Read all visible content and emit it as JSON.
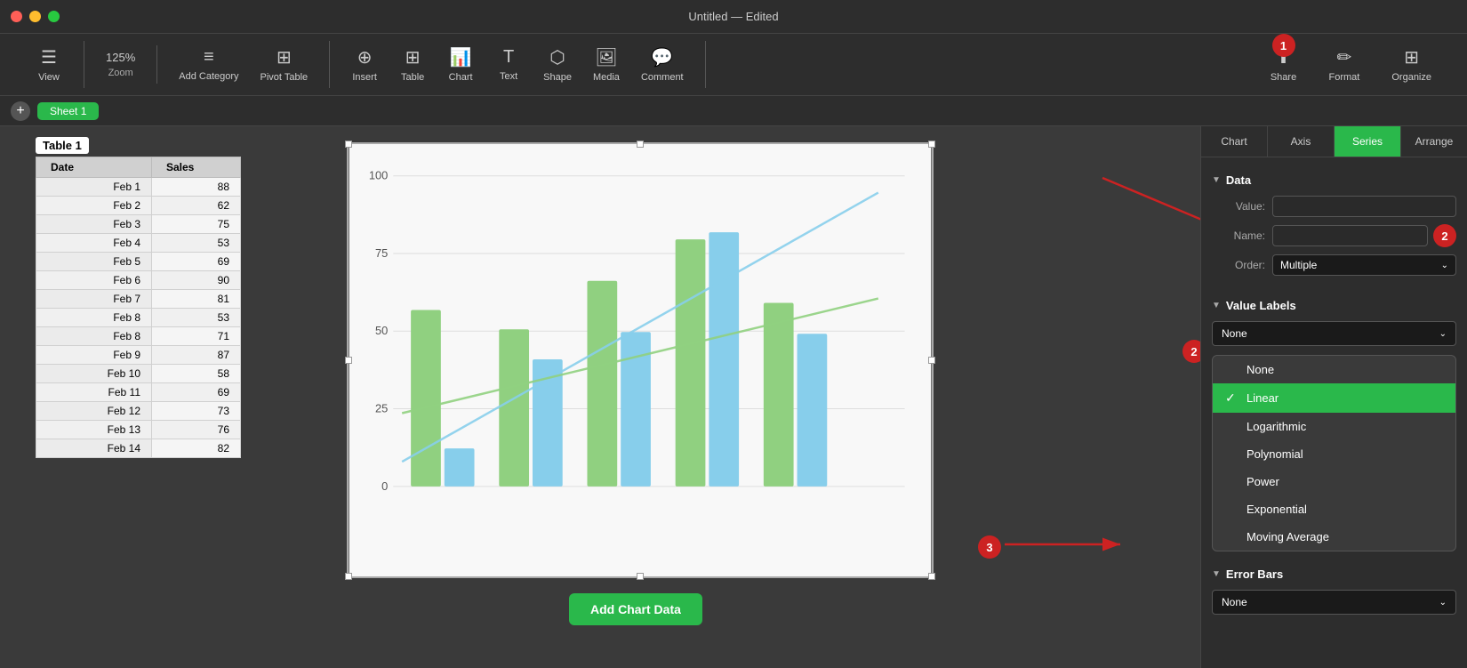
{
  "window": {
    "title": "Untitled — Edited",
    "traffic_lights": [
      "red",
      "yellow",
      "green"
    ]
  },
  "toolbar": {
    "view_label": "View",
    "zoom_value": "125%",
    "zoom_label": "Zoom",
    "add_category_label": "Add Category",
    "pivot_table_label": "Pivot Table",
    "insert_label": "Insert",
    "table_label": "Table",
    "chart_label": "Chart",
    "text_label": "Text",
    "shape_label": "Shape",
    "media_label": "Media",
    "comment_label": "Comment",
    "share_label": "Share",
    "format_label": "Format",
    "organize_label": "Organize"
  },
  "sheets": {
    "add_label": "+",
    "tabs": [
      {
        "name": "Sheet 1",
        "active": true
      }
    ]
  },
  "table": {
    "title": "Table 1",
    "columns": [
      "Date",
      "Sales"
    ],
    "rows": [
      [
        "Feb 1",
        "88"
      ],
      [
        "Feb 2",
        "62"
      ],
      [
        "Feb 3",
        "75"
      ],
      [
        "Feb 4",
        "53"
      ],
      [
        "Feb 5",
        "69"
      ],
      [
        "Feb 6",
        "90"
      ],
      [
        "Feb 7",
        "81"
      ],
      [
        "Feb 8",
        "53"
      ],
      [
        "Feb 8",
        "71"
      ],
      [
        "Feb 9",
        "87"
      ],
      [
        "Feb 10",
        "58"
      ],
      [
        "Feb 11",
        "69"
      ],
      [
        "Feb 12",
        "73"
      ],
      [
        "Feb 13",
        "76"
      ],
      [
        "Feb 14",
        "82"
      ]
    ]
  },
  "chart": {
    "y_labels": [
      "100",
      "75",
      "50",
      "25",
      "0"
    ],
    "add_data_label": "Add Chart Data"
  },
  "right_panel": {
    "tabs": [
      "Chart",
      "Axis",
      "Series",
      "Arrange"
    ],
    "active_tab": "Series",
    "data_section": {
      "title": "Data",
      "value_label": "Value:",
      "name_label": "Name:",
      "order_label": "Order:",
      "order_value": "Multiple"
    },
    "value_labels_section": {
      "title": "Value Labels",
      "current_value": "None"
    },
    "dropdown_items": [
      {
        "label": "None",
        "selected": false
      },
      {
        "label": "Linear",
        "selected": true
      },
      {
        "label": "Logarithmic",
        "selected": false
      },
      {
        "label": "Polynomial",
        "selected": false
      },
      {
        "label": "Power",
        "selected": false
      },
      {
        "label": "Exponential",
        "selected": false
      },
      {
        "label": "Moving Average",
        "selected": false
      }
    ],
    "error_bars_section": {
      "title": "Error Bars",
      "current_value": "None"
    }
  },
  "step_badges": [
    {
      "number": "1",
      "label": "step-1"
    },
    {
      "number": "2",
      "label": "step-2"
    },
    {
      "number": "3",
      "label": "step-3"
    }
  ]
}
